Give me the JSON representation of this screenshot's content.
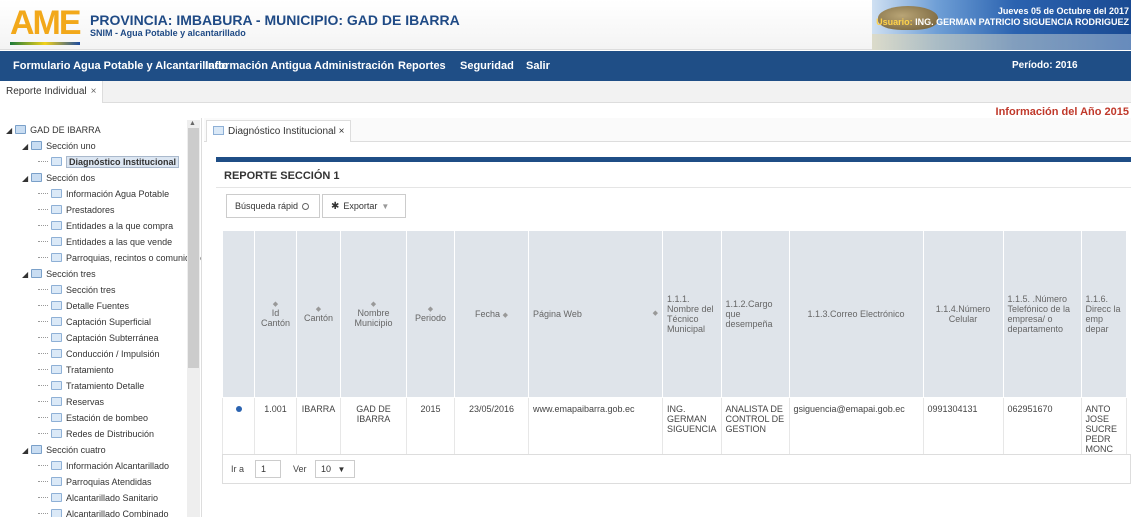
{
  "header": {
    "logo_text": "AME",
    "title": "PROVINCIA: IMBABURA - MUNICIPIO: GAD DE IBARRA",
    "subtitle": "SNIM - Agua Potable y alcantarillado",
    "date": "Jueves 05 de Octubre del 2017",
    "user_label": "Usuario:",
    "user_name": "ING. GERMAN PATRICIO SIGUENCIA RODRIGUEZ"
  },
  "nav": {
    "items": [
      "Formulario Agua Potable y Alcantarillado",
      "Información Antigua",
      "Administración",
      "Reportes",
      "Seguridad",
      "Salir"
    ],
    "period": "Período: 2016"
  },
  "top_tab": {
    "label": "Reporte Individual",
    "close": "×"
  },
  "info_year": "Información del Año 2015",
  "tree": {
    "root": "GAD DE IBARRA",
    "rows": [
      {
        "label": "Sección uno",
        "type": "folder"
      },
      {
        "label": "Diagnóstico Institucional",
        "type": "page"
      },
      {
        "label": "Sección dos",
        "type": "folder"
      },
      {
        "label": "Información Agua Potable",
        "type": "page"
      },
      {
        "label": "Prestadores",
        "type": "page"
      },
      {
        "label": "Entidades a la que compra",
        "type": "page"
      },
      {
        "label": "Entidades a las que vende",
        "type": "page"
      },
      {
        "label": "Parroquias, recintos o comunidades",
        "type": "page"
      },
      {
        "label": "Sección tres",
        "type": "folder"
      },
      {
        "label": "Sección tres",
        "type": "page"
      },
      {
        "label": "Detalle Fuentes",
        "type": "page"
      },
      {
        "label": "Captación Superficial",
        "type": "page"
      },
      {
        "label": "Captación Subterránea",
        "type": "page"
      },
      {
        "label": "Conducción / Impulsión",
        "type": "page"
      },
      {
        "label": "Tratamiento",
        "type": "page"
      },
      {
        "label": "Tratamiento Detalle",
        "type": "page"
      },
      {
        "label": "Reservas",
        "type": "page"
      },
      {
        "label": "Estación de bombeo",
        "type": "page"
      },
      {
        "label": "Redes de Distribución",
        "type": "page"
      },
      {
        "label": "Sección cuatro",
        "type": "folder"
      },
      {
        "label": "Información Alcantarillado",
        "type": "page"
      },
      {
        "label": "Parroquias Atendidas",
        "type": "page"
      },
      {
        "label": "Alcantarillado Sanitario",
        "type": "page"
      },
      {
        "label": "Alcantarillado Combinado",
        "type": "page"
      }
    ]
  },
  "inner_tab": {
    "label": "Diagnóstico Institucional",
    "close": "×"
  },
  "section_title": "REPORTE SECCIÓN 1",
  "toolbar": {
    "search_label": "Búsqueda rápid",
    "export_label": "Exportar"
  },
  "table": {
    "headers": [
      "Id Cantón",
      "Cantón",
      "Nombre Municipio",
      "Periodo",
      "Fecha",
      "Página Web",
      "1.1.1. Nombre del Técnico Municipal",
      "1.1.2.Cargo que desempeña",
      "1.1.3.Correo Electrónico",
      "1.1.4.Número Celular",
      "1.1.5. .Número Telefónico de la empresa/ o departamento",
      "1.1.6. Direcc la emp depar"
    ],
    "row": [
      "1.001",
      "IBARRA",
      "GAD DE IBARRA",
      "2015",
      "23/05/2016",
      "www.emapaibarra.gob.ec",
      "ING. GERMAN SIGUENCIA",
      "ANALISTA DE CONTROL DE GESTION",
      "gsiguencia@emapai.gob.ec",
      "0991304131",
      "062951670",
      "ANTO JOSE SUCRE PEDR MONC"
    ]
  },
  "pager": {
    "goto_label": "Ir a",
    "page_value": "1",
    "view_label": "Ver",
    "page_size": "10"
  }
}
